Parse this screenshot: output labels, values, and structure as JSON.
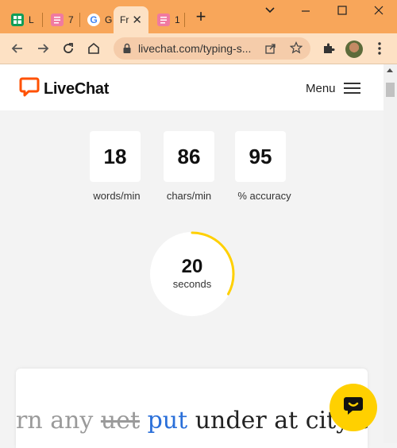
{
  "browser": {
    "tabs": [
      {
        "label": "L",
        "favicon": "sheets-icon",
        "color": "#0f9d58"
      },
      {
        "label": "7",
        "favicon": "notes-icon",
        "color": "#f07aa0"
      },
      {
        "label": "G",
        "favicon": "google-icon",
        "color": "#ffffff"
      },
      {
        "label": "Fr",
        "favicon": "livechat-icon",
        "color": "#ff5100",
        "active": true
      },
      {
        "label": "1",
        "favicon": "notes-icon",
        "color": "#f07aa0"
      }
    ],
    "url": "livechat.com/typing-s..."
  },
  "site": {
    "logo_text": "LiveChat",
    "menu_label": "Menu",
    "brand_color": "#ff5100"
  },
  "stats": [
    {
      "value": "18",
      "label": "words/min"
    },
    {
      "value": "86",
      "label": "chars/min"
    },
    {
      "value": "95",
      "label": "% accuracy"
    }
  ],
  "timer": {
    "value": "20",
    "unit": "seconds",
    "progress": 0.33,
    "color": "#ffd000"
  },
  "typing": {
    "done": "rn any",
    "wrong": "uet",
    "current": "put",
    "next": "under at city c"
  },
  "chat_button": {
    "icon": "chat-bubble-icon"
  }
}
